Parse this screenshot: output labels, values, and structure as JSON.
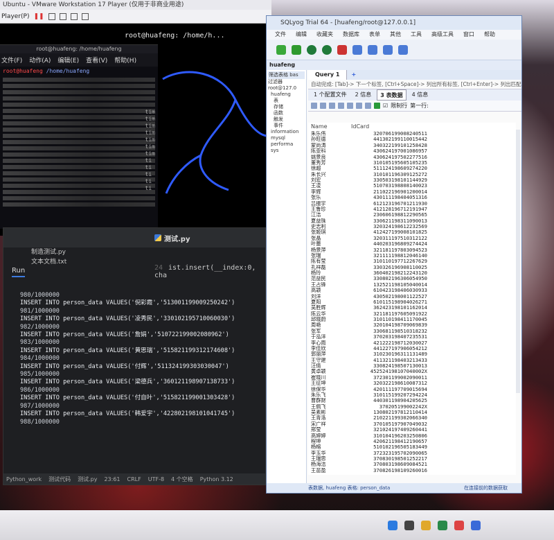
{
  "vmware": {
    "title": "Ubuntu - VMware Workstation 17 Player (仅用于非商业用途)",
    "menu_player": "Player(P)",
    "tab_path": "root@huafeng: /home/h..."
  },
  "terminal": {
    "title": "root@huafeng: /home/huafeng",
    "menu": [
      "文件(F)",
      "动作(A)",
      "编辑(E)",
      "查看(V)",
      "帮助(H)"
    ],
    "prompt_user": "root@huafeng",
    "prompt_path": "/home/huafeng",
    "side_text": [
      "tim",
      "tim",
      "tim",
      "tim",
      "tim",
      "tim",
      "tim",
      "ti",
      "ti",
      "ti",
      "ti",
      "ti"
    ]
  },
  "ide": {
    "tab_file": "测试.py",
    "files": [
      "制造测试.py",
      "文本文档.txt"
    ],
    "code_lines": [
      {
        "ln": "24",
        "text": "ist.insert(__index:0, cha"
      }
    ],
    "run_tab": "Run",
    "console": [
      {
        "count": "980/1000000",
        "insert": "INSERT INTO person_data VALUES('倪彩霞','513001199009250242')"
      },
      {
        "count": "981/1000000",
        "insert": "INSERT INTO person_data VALUES('凌秀民','330102195710060030')"
      },
      {
        "count": "982/1000000",
        "insert": "INSERT INTO person_data VALUES('詹娟','510722199002080962')"
      },
      {
        "count": "983/1000000",
        "insert": "INSERT INTO person_data VALUES('黄思瑞','515821199312174608')"
      },
      {
        "count": "984/1000000",
        "insert": "INSERT INTO person_data VALUES('付辉','511324199303030047')"
      },
      {
        "count": "985/1000000",
        "insert": "INSERT INTO person_data VALUES('梁德兵','360121198907138733')"
      },
      {
        "count": "986/1000000",
        "insert": "INSERT INTO person_data VALUES('付自叶','515821199001303428')"
      },
      {
        "count": "987/1000000",
        "insert": "INSERT INTO person_data VALUES('韩爱宇','422802198101041745')"
      },
      {
        "count": "988/1000000",
        "insert": ""
      }
    ],
    "status": [
      "Python_work",
      "测试代码",
      "测试.py",
      "23:61",
      "CRLF",
      "UTF-8",
      "4 个空格",
      "Python 3.12"
    ]
  },
  "sqlyog": {
    "title": "SQLyog Trial 64 - [huafeng/root@127.0.0.1]",
    "menu": [
      "文件",
      "编辑",
      "收藏夹",
      "数据库",
      "表单",
      "其他",
      "工具",
      "高级工具",
      "窗口",
      "帮助"
    ],
    "connection_tab": "huafeng",
    "left_header": "筛选表格 bas",
    "left_filter": "过滤器",
    "tree": [
      "root@127.0",
      "huafeng",
      "表",
      "存储",
      "函数",
      "触发",
      "事件",
      "information",
      "mysql",
      "performa",
      "sys"
    ],
    "query_tab": "Query 1",
    "hint": "自动完成: [Tab]-> 下一个标签, [Ctrl+Space]-> 列出所有标签, [Ctrl+Enter]-> 列出匹配标签",
    "result_tabs": [
      "1 个配置文件",
      "2 信息",
      "3 表数据",
      "4 信息"
    ],
    "limit_label": "限制行",
    "first_row_label": "第一行:",
    "columns": [
      "Name",
      "IdCard"
    ],
    "rows": [
      [
        "朱乐伟",
        "320706199008240511"
      ],
      [
        "孙旺德",
        "441302199110015442"
      ],
      [
        "蒙尚涛",
        "340322199101258428"
      ],
      [
        "陈亚科",
        "430624197001086957"
      ],
      [
        "姚景良",
        "430624197502277516"
      ],
      [
        "董秀芳",
        "310105195605105235"
      ],
      [
        "徐超",
        "511124198609274220"
      ],
      [
        "朱长兴",
        "310101196309125272"
      ],
      [
        "刘宏",
        "330503198101144929"
      ],
      [
        "王凌",
        "510703198808140023"
      ],
      [
        "李辉",
        "211022196901200014"
      ],
      [
        "张乐",
        "430111198404051316"
      ],
      [
        "吕振宇",
        "612123196701211930"
      ],
      [
        "王鲁珍",
        "412128196712191947"
      ],
      [
        "江洁",
        "230606198812290565"
      ],
      [
        "夏益珠",
        "330621198311090013"
      ],
      [
        "史志利",
        "320324198612232569"
      ],
      [
        "张姬琪",
        "412427199008101825"
      ],
      [
        "张晶",
        "320311197510312122"
      ],
      [
        "叶蕾",
        "440203196809274424"
      ],
      [
        "杨景萍",
        "321181197803094523"
      ],
      [
        "张瑞",
        "321111198812046140"
      ],
      [
        "陈有莹",
        "310110197712267629"
      ],
      [
        "孔祥磊",
        "330326196908110025"
      ],
      [
        "杨玲",
        "360402198212243120"
      ],
      [
        "范益民",
        "330802196306054950"
      ],
      [
        "王占锋",
        "132521198105040014"
      ],
      [
        "高颖",
        "610423198406030933"
      ],
      [
        "刘洋",
        "430502198001122527"
      ],
      [
        "夏阳",
        "610115198904026271"
      ],
      [
        "吴胜辉",
        "362423198101162014"
      ],
      [
        "陈云华",
        "321181197605091922"
      ],
      [
        "邱晓蔚",
        "310110198411170045"
      ],
      [
        "周艳",
        "320104198709069839"
      ],
      [
        "张军",
        "330681198510318232"
      ],
      [
        "于泓洋",
        "370203198407235531"
      ],
      [
        "李心雨",
        "421222198712030027"
      ],
      [
        "李佳欣",
        "441227197906054212"
      ],
      [
        "郭丽萍",
        "310230196311131489"
      ],
      [
        "王守建",
        "411321198403213433"
      ],
      [
        "汪倩",
        "330824198507130013"
      ],
      [
        "黄卓颖",
        "452524198107040002X"
      ],
      [
        "崔晓川",
        "372301199002090011"
      ],
      [
        "王征坤",
        "320322198610087312"
      ],
      [
        "徐保华",
        "420111197709015694"
      ],
      [
        "朱乐飞",
        "310115199207294224"
      ],
      [
        "曹群财",
        "440301198904205625"
      ],
      [
        "王佩飞",
        "370205199002242X"
      ],
      [
        "吴素彬",
        "130802197812110414"
      ],
      [
        "王青洛",
        "210221199302066340"
      ],
      [
        "宋广祥",
        "370105197907049032"
      ],
      [
        "邢莹",
        "321024197409260441"
      ],
      [
        "高婷婷",
        "310104196203250806"
      ],
      [
        "程坤",
        "420621198412190657"
      ],
      [
        "杨榕",
        "510102196505183449"
      ],
      [
        "李玉华",
        "372323195702090065"
      ],
      [
        "王瑞思",
        "370830198501252217"
      ],
      [
        "杨海洁",
        "370803198609084521"
      ],
      [
        "王苗盈",
        "370826198109260016"
      ]
    ],
    "status_left": "表数据, huafeng 表格: person_data",
    "status_right": "在连接前的数据获取"
  },
  "colors": {
    "accent_blue": "#3d7be0",
    "prompt_red": "#ff4a4a",
    "dragon_blue": "#2f5bff"
  }
}
